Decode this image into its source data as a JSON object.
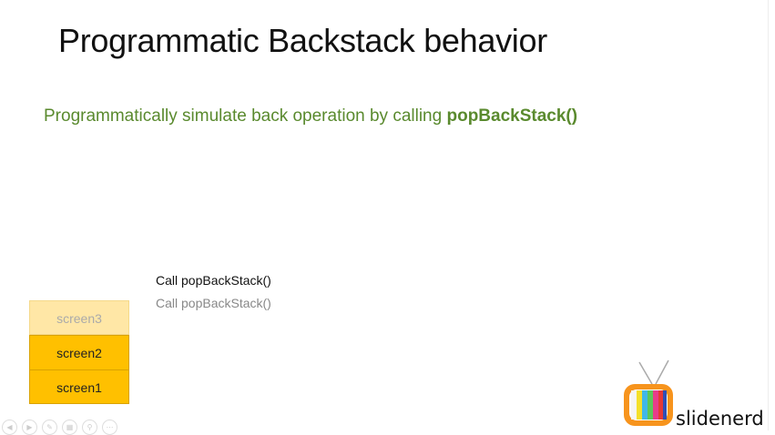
{
  "slide": {
    "title": "Programmatic Backstack behavior",
    "subtitle_prefix": "Programmatically simulate back operation by calling ",
    "subtitle_bold": "popBackStack()",
    "calls": [
      "Call popBackStack()",
      "Call popBackStack()"
    ],
    "stack": [
      "screen3",
      "screen2",
      "screen1"
    ],
    "colors": {
      "title": "#111111",
      "subtitle": "#5a8a2e",
      "stack_active": "#ffc000",
      "stack_popped": "#ffe7a6"
    }
  },
  "logo": {
    "text": "slidenerd"
  },
  "controls": [
    "prev-icon",
    "next-icon",
    "pen-icon",
    "slides-icon",
    "zoom-icon",
    "more-icon"
  ]
}
